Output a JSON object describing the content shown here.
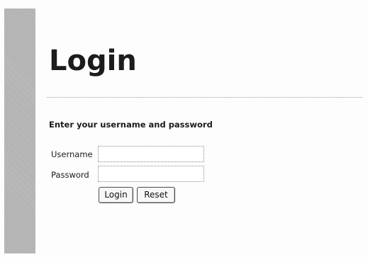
{
  "page": {
    "title": "Login"
  },
  "form": {
    "instructions": "Enter your username and password",
    "username": {
      "label": "Username",
      "value": "",
      "placeholder": ""
    },
    "password": {
      "label": "Password",
      "value": "",
      "placeholder": ""
    },
    "buttons": {
      "login_label": "Login",
      "reset_label": "Reset"
    }
  },
  "colors": {
    "background": "#fdfdfd",
    "left_bar": "#bcbcbc",
    "text": "#1a1a1a"
  }
}
